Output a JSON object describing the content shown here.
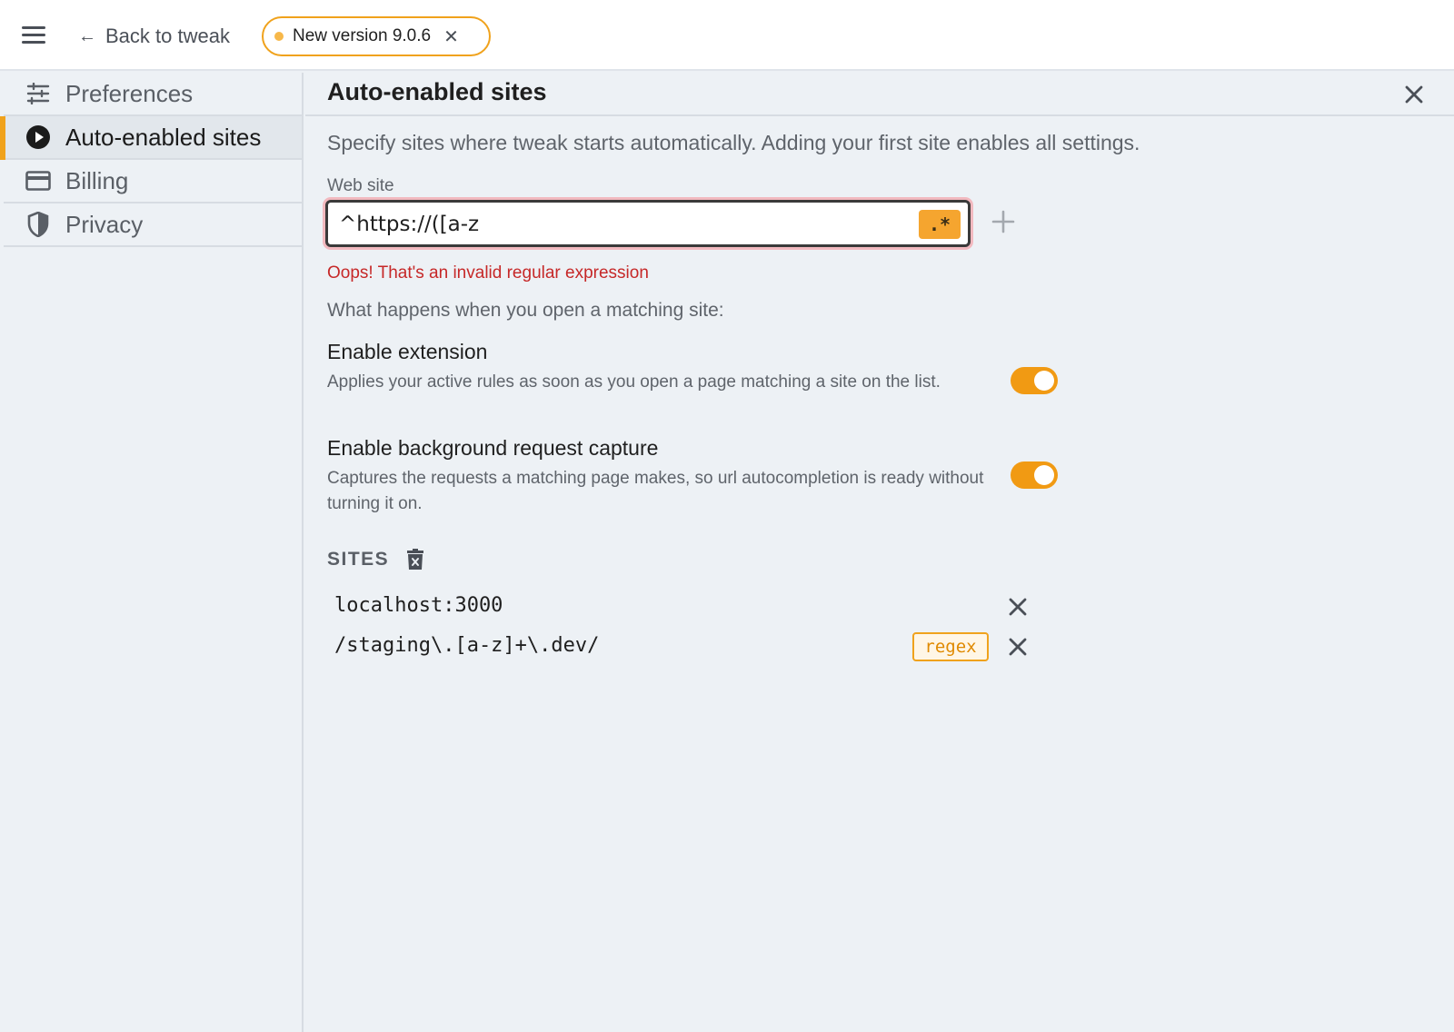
{
  "topbar": {
    "back_label": "Back to tweak",
    "version_label": "New version 9.0.6"
  },
  "sidebar": {
    "items": [
      {
        "label": "Preferences",
        "icon": "sliders-icon"
      },
      {
        "label": "Auto-enabled sites",
        "icon": "play-circle-icon",
        "active": true
      },
      {
        "label": "Billing",
        "icon": "credit-card-icon"
      },
      {
        "label": "Privacy",
        "icon": "shield-icon"
      }
    ]
  },
  "main": {
    "title": "Auto-enabled sites",
    "description": "Specify sites where tweak starts automatically. Adding your first site enables all settings.",
    "field_label": "Web site",
    "input_value": "^https://([a-z",
    "regex_toggle_label": ".*",
    "error": "Oops! That's an invalid regular expression",
    "section_sub": "What happens when you open a matching site:",
    "settings": [
      {
        "title": "Enable extension",
        "desc": "Applies your active rules as soon as you open a page matching a site on the list.",
        "enabled": true
      },
      {
        "title": "Enable background request capture",
        "desc": "Captures the requests a matching page makes, so url autocompletion is ready without turning it on.",
        "enabled": true
      }
    ],
    "sites_heading": "SITES",
    "sites": [
      {
        "url": "localhost:3000",
        "badge": ""
      },
      {
        "url": "/staging\\.[a-z]+\\.dev/",
        "badge": "regex"
      }
    ]
  },
  "colors": {
    "accent": "#f0a21c",
    "error": "#c62828",
    "background": "#edf1f5"
  }
}
